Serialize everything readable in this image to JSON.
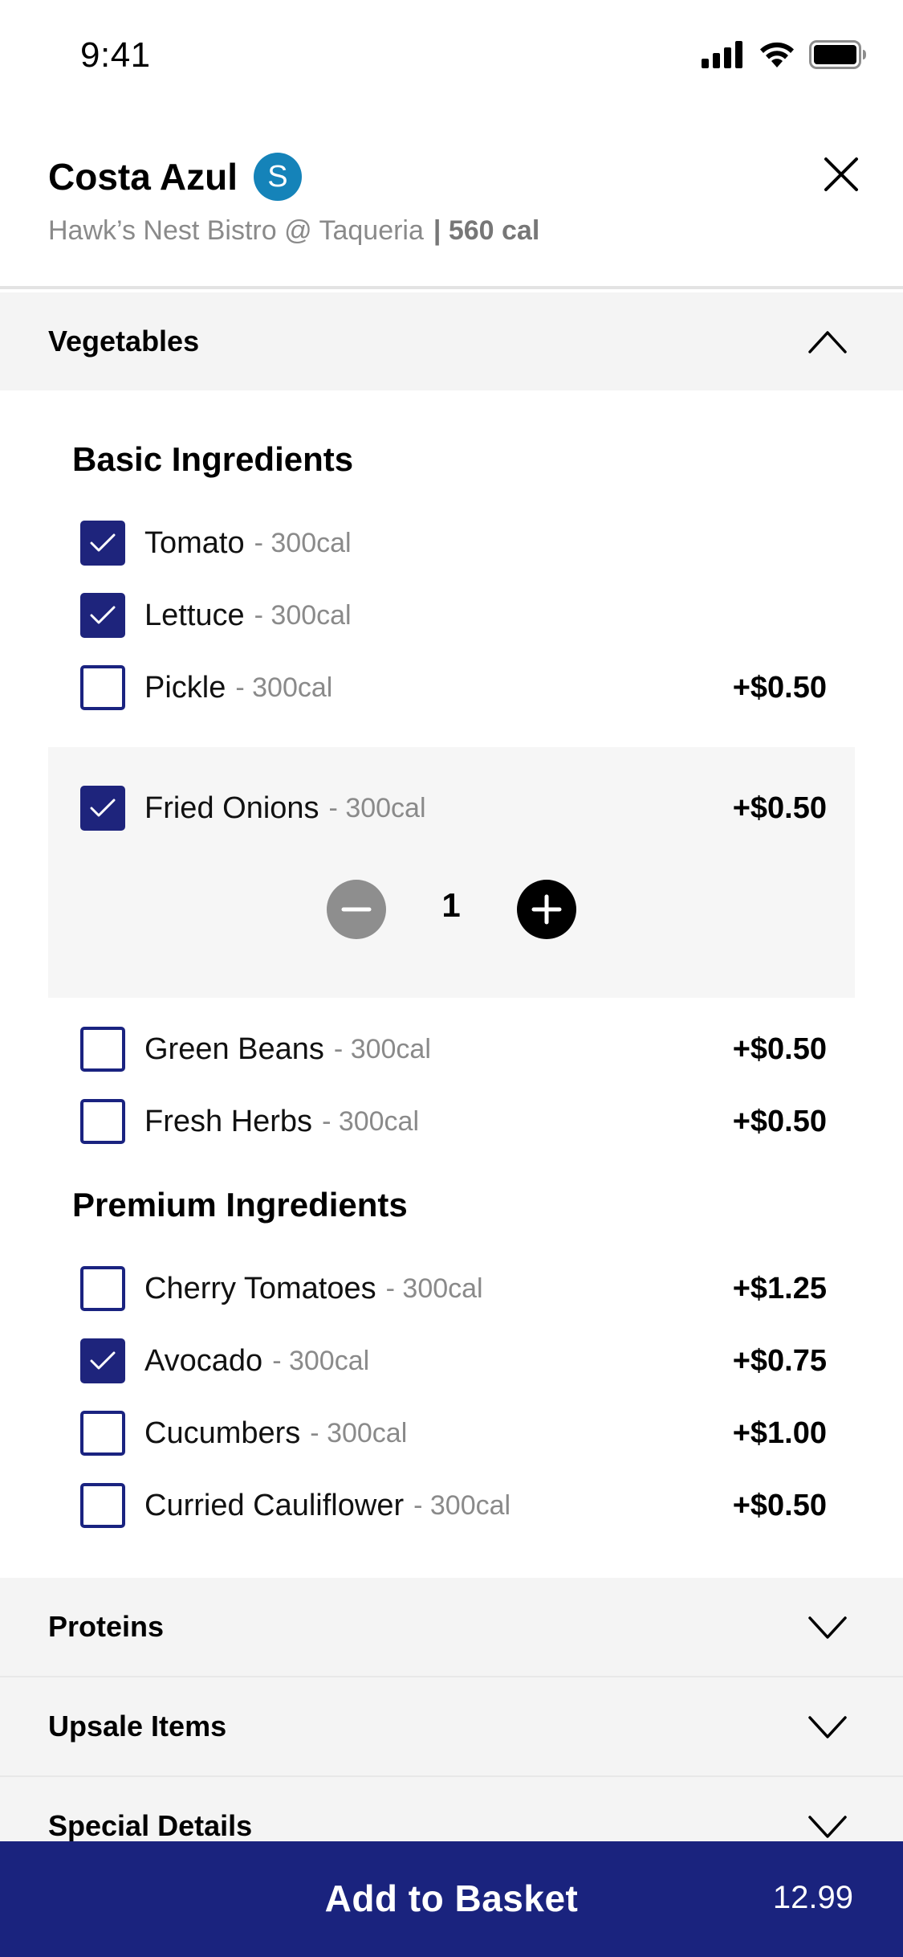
{
  "status": {
    "time": "9:41"
  },
  "header": {
    "title": "Costa Azul",
    "avatar_letter": "S",
    "location": "Hawk’s Nest Bistro @ Taqueria",
    "calories": "| 560 cal"
  },
  "sections": {
    "vegetables": "Vegetables",
    "proteins": "Proteins",
    "upsale": "Upsale Items",
    "special": "Special Details"
  },
  "groups": {
    "basic": "Basic Ingredients",
    "premium": "Premium Ingredients"
  },
  "basic_items": [
    {
      "name": "Tomato",
      "cal": "- 300cal",
      "price": "",
      "checked": true
    },
    {
      "name": "Lettuce",
      "cal": "- 300cal",
      "price": "",
      "checked": true
    },
    {
      "name": "Pickle",
      "cal": "- 300cal",
      "price": "+$0.50",
      "checked": false
    },
    {
      "name": "Fried Onions",
      "cal": "- 300cal",
      "price": "+$0.50",
      "checked": true
    },
    {
      "name": "Green Beans",
      "cal": "- 300cal",
      "price": "+$0.50",
      "checked": false
    },
    {
      "name": "Fresh Herbs",
      "cal": "- 300cal",
      "price": "+$0.50",
      "checked": false
    }
  ],
  "premium_items": [
    {
      "name": "Cherry Tomatoes",
      "cal": "- 300cal",
      "price": "+$1.25",
      "checked": false
    },
    {
      "name": "Avocado",
      "cal": "- 300cal",
      "price": "+$0.75",
      "checked": true
    },
    {
      "name": "Cucumbers",
      "cal": "- 300cal",
      "price": "+$1.00",
      "checked": false
    },
    {
      "name": "Curried Cauliflower",
      "cal": "- 300cal",
      "price": "+$0.50",
      "checked": false
    }
  ],
  "stepper": {
    "value": "1"
  },
  "footer": {
    "add_label": "Add to Basket",
    "total": "12.99"
  },
  "colors": {
    "primary": "#1a237e",
    "avatar": "#1583b9",
    "section_bg": "#f4f4f4"
  }
}
